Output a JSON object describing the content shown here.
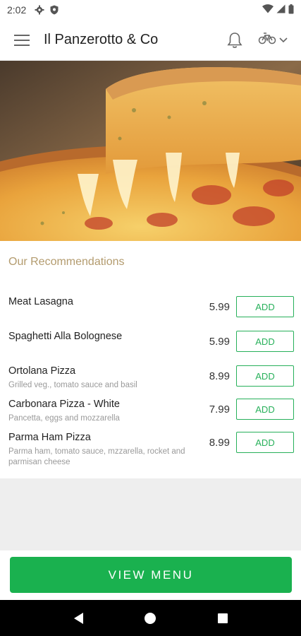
{
  "status_bar": {
    "time": "2:02",
    "icons": [
      "gear-icon",
      "shield-icon",
      "wifi-icon",
      "signal-icon",
      "battery-icon"
    ]
  },
  "app_bar": {
    "title": "Il Panzerotto & Co",
    "icons": [
      "hamburger-menu-icon",
      "bell-icon",
      "bicycle-icon",
      "chevron-down-icon"
    ]
  },
  "hero": {
    "image": "pizza-slice-photo"
  },
  "recommendations": {
    "title": "Our Recommendations",
    "add_label": "ADD",
    "items": [
      {
        "name": "Meat Lasagna",
        "description": "",
        "price": "5.99"
      },
      {
        "name": "Spaghetti Alla Bolognese",
        "description": "",
        "price": "5.99"
      },
      {
        "name": "Ortolana Pizza",
        "description": "Grilled veg., tomato sauce and basil",
        "price": "8.99"
      },
      {
        "name": "Carbonara Pizza - White",
        "description": "Pancetta, eggs and mozzarella",
        "price": "7.99"
      },
      {
        "name": "Parma Ham Pizza",
        "description": "Parma ham, tomato sauce, mzzarella, rocket and parmisan cheese",
        "price": "8.99"
      }
    ]
  },
  "view_menu_label": "VIEW MENU",
  "colors": {
    "accent": "#1ab14f",
    "section_title": "#b39b6e"
  },
  "nav_bar": {
    "icons": [
      "back-icon",
      "home-icon",
      "recents-icon"
    ]
  }
}
